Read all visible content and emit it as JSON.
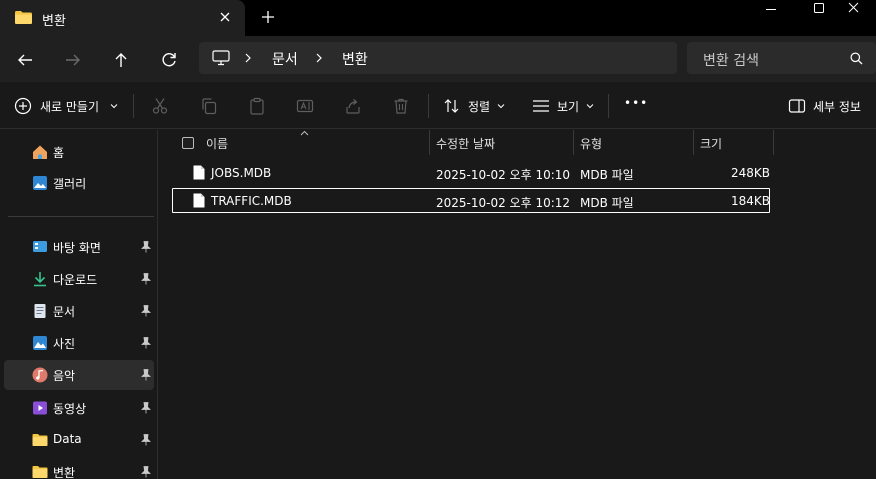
{
  "window": {
    "tab_title": "변환",
    "new_tab_glyph": "+"
  },
  "nav": {
    "breadcrumb": [
      "문서",
      "변환"
    ],
    "search_placeholder": "변환 검색"
  },
  "toolbar": {
    "new_label": "새로 만들기",
    "sort_label": "정렬",
    "view_label": "보기",
    "more_glyph": "•••",
    "details_label": "세부 정보"
  },
  "sidebar": {
    "items": [
      {
        "label": "홈",
        "icon": "home-icon",
        "pinned": false
      },
      {
        "label": "갤러리",
        "icon": "gallery-icon",
        "pinned": false
      },
      {
        "label": "바탕 화면",
        "icon": "desktop-icon",
        "pinned": true
      },
      {
        "label": "다운로드",
        "icon": "download-icon",
        "pinned": true
      },
      {
        "label": "문서",
        "icon": "document-icon",
        "pinned": true
      },
      {
        "label": "사진",
        "icon": "pictures-icon",
        "pinned": true
      },
      {
        "label": "음악",
        "icon": "music-icon",
        "pinned": true,
        "selected": true
      },
      {
        "label": "동영상",
        "icon": "video-icon",
        "pinned": true
      },
      {
        "label": "Data",
        "icon": "folder-icon",
        "pinned": true
      },
      {
        "label": "변환",
        "icon": "folder-icon",
        "pinned": true
      }
    ]
  },
  "columns": {
    "name": "이름",
    "modified": "수정한 날짜",
    "type": "유형",
    "size": "크기"
  },
  "files": [
    {
      "name": "JOBS.MDB",
      "modified": "2025-10-02 오후 10:10",
      "type": "MDB 파일",
      "size": "248KB"
    },
    {
      "name": "TRAFFIC.MDB",
      "modified": "2025-10-02 오후 10:12",
      "type": "MDB 파일",
      "size": "184KB"
    }
  ],
  "colors": {
    "titlebar": "#000000",
    "chrome": "#202020",
    "background": "#191919",
    "accent_folder": "#f4c542"
  }
}
